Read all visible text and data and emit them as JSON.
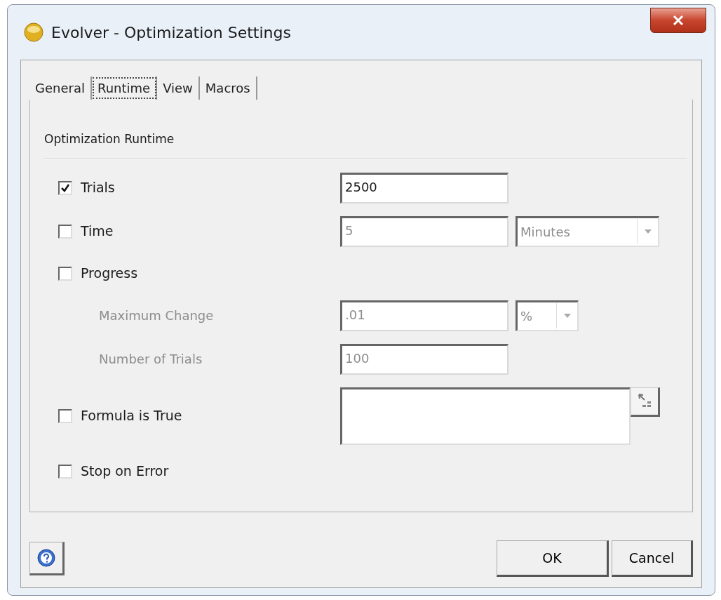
{
  "window": {
    "title": "Evolver - Optimization Settings"
  },
  "tabs": [
    {
      "label": "General",
      "selected": false
    },
    {
      "label": "Runtime",
      "selected": true
    },
    {
      "label": "View",
      "selected": false
    },
    {
      "label": "Macros",
      "selected": false
    }
  ],
  "section": {
    "title": "Optimization Runtime"
  },
  "rows": [
    {
      "kind": "checkbox",
      "label": "Trials",
      "checked": true,
      "field": {
        "kind": "text",
        "value": "2500",
        "disabled": false
      }
    },
    {
      "kind": "checkbox",
      "label": "Time",
      "checked": false,
      "field": {
        "kind": "text",
        "value": "5",
        "disabled": true
      },
      "dropdown": {
        "value": "Minutes",
        "disabled": true
      }
    },
    {
      "kind": "checkbox",
      "label": "Progress",
      "checked": false
    },
    {
      "kind": "sublabel",
      "label": "Maximum Change",
      "disabled": true,
      "field": {
        "kind": "text",
        "value": ".01",
        "disabled": true
      },
      "dropdown": {
        "value": "%",
        "disabled": true
      }
    },
    {
      "kind": "sublabel",
      "label": "Number of Trials",
      "disabled": true,
      "field": {
        "kind": "text",
        "value": "100",
        "disabled": true
      }
    },
    {
      "kind": "checkbox",
      "label": "Formula is True",
      "checked": false,
      "field": {
        "kind": "formula"
      }
    },
    {
      "kind": "checkbox",
      "label": "Stop on Error",
      "checked": false
    }
  ],
  "buttons": [
    {
      "label": "OK"
    },
    {
      "label": "Cancel"
    }
  ]
}
